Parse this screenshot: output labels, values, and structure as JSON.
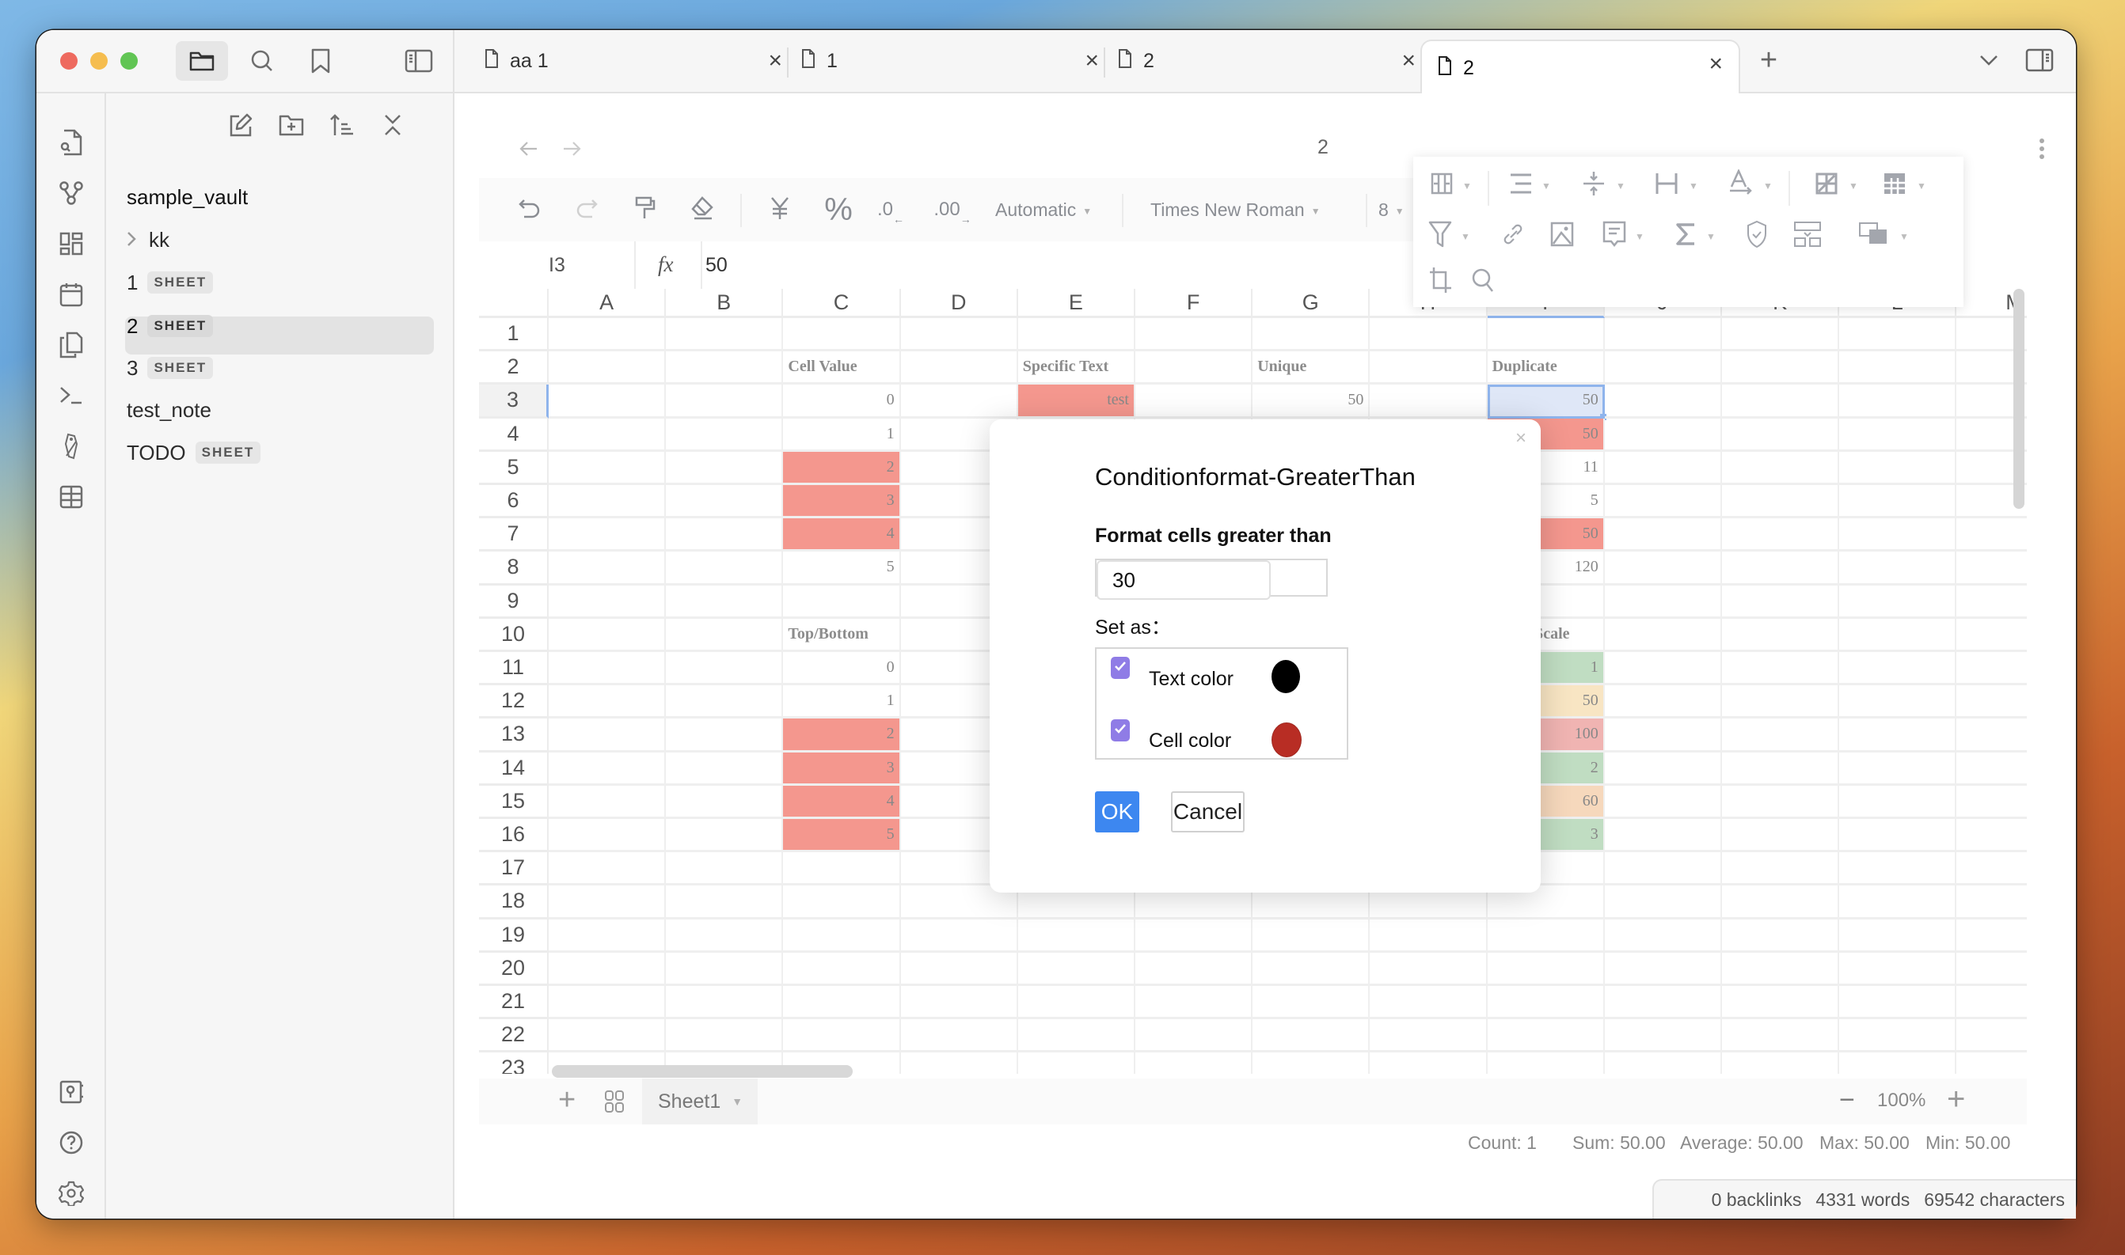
{
  "window": {
    "traffic_lights": {
      "close": "#ee6a5f",
      "minimize": "#f5bd4f",
      "maximize": "#61c554"
    },
    "top_icons": [
      "folder-icon",
      "search-icon",
      "bookmark-icon",
      "sidebar-toggle-icon"
    ]
  },
  "tabs": [
    {
      "label": "aa 1",
      "active": false
    },
    {
      "label": "1",
      "active": false
    },
    {
      "label": "2",
      "active": false
    },
    {
      "label": "2",
      "active": true
    }
  ],
  "tab_controls": {
    "new_tab": "+",
    "close": "×"
  },
  "nav": {
    "title": "2"
  },
  "ribbon": {
    "top": [
      "file-search-icon",
      "graph-icon",
      "dashboard-icon",
      "calendar-icon",
      "copy-icon",
      "terminal-icon",
      "tag-icon",
      "table-icon"
    ],
    "bottom": [
      "vault-icon",
      "help-icon",
      "settings-icon"
    ]
  },
  "sidebar": {
    "actions": [
      "new-note-icon",
      "new-folder-icon",
      "sort-icon",
      "collapse-icon"
    ],
    "vault_name": "sample_vault",
    "items": [
      {
        "label": "kk",
        "type": "folder",
        "badge": null
      },
      {
        "label": "1",
        "badge": "SHEET"
      },
      {
        "label": "2",
        "badge": "SHEET",
        "active": true
      },
      {
        "label": "3",
        "badge": "SHEET"
      },
      {
        "label": "test_note",
        "badge": null
      },
      {
        "label": "TODO",
        "badge": "SHEET"
      }
    ]
  },
  "toolbar": {
    "number_format": "Automatic",
    "font_family": "Times New Roman",
    "font_size": "8",
    "icons": [
      "undo-icon",
      "redo-icon",
      "format-painter-icon",
      "clear-format-icon",
      "currency-icon",
      "percent-icon",
      "decrease-decimal-icon",
      "increase-decimal-icon"
    ],
    "decrease_decimal": ".0",
    "increase_decimal": ".00"
  },
  "floating_toolbar": {
    "icons": [
      "merge-cells-icon",
      "horizontal-align-icon",
      "vertical-align-icon",
      "text-wrap-icon",
      "text-rotate-icon",
      "border-icon",
      "freeze-icon",
      "filter-icon",
      "link-icon",
      "image-icon",
      "comment-icon",
      "sum-icon",
      "protect-icon",
      "split-column-icon",
      "conditional-format-icon",
      "crop-icon",
      "find-icon"
    ]
  },
  "formula_bar": {
    "cell_ref": "I3",
    "fx": "fx",
    "value": "50"
  },
  "grid": {
    "columns": [
      "A",
      "B",
      "C",
      "D",
      "E",
      "F",
      "G",
      "H",
      "I",
      "J",
      "K",
      "L",
      "M"
    ],
    "rows": [
      "1",
      "2",
      "3",
      "4",
      "5",
      "6",
      "7",
      "8",
      "9",
      "10",
      "11",
      "12",
      "13",
      "14",
      "15",
      "16",
      "17",
      "18",
      "19",
      "20",
      "21",
      "22",
      "23"
    ],
    "selected_cell": "I3",
    "cells": [
      {
        "ref": "C2",
        "value": "Cell Value",
        "header": true
      },
      {
        "ref": "E2",
        "value": "Specific Text",
        "header": true
      },
      {
        "ref": "G2",
        "value": "Unique",
        "header": true
      },
      {
        "ref": "I2",
        "value": "Duplicate",
        "header": true
      },
      {
        "ref": "C3",
        "value": "0"
      },
      {
        "ref": "E3",
        "value": "test",
        "fill": "#f4978e"
      },
      {
        "ref": "G3",
        "value": "50"
      },
      {
        "ref": "I3",
        "value": "50",
        "fill": "#dfe7f7"
      },
      {
        "ref": "C4",
        "value": "1"
      },
      {
        "ref": "I4",
        "value": "50",
        "fill": "#f4978e"
      },
      {
        "ref": "C5",
        "value": "2",
        "fill": "#f4978e"
      },
      {
        "ref": "I5",
        "value": "11"
      },
      {
        "ref": "C6",
        "value": "3",
        "fill": "#f4978e"
      },
      {
        "ref": "I6",
        "value": "5"
      },
      {
        "ref": "C7",
        "value": "4",
        "fill": "#f4978e"
      },
      {
        "ref": "I7",
        "value": "50",
        "fill": "#f4978e"
      },
      {
        "ref": "C8",
        "value": "5"
      },
      {
        "ref": "I8",
        "value": "120"
      },
      {
        "ref": "C10",
        "value": "Top/Bottom",
        "header": true
      },
      {
        "ref": "I10",
        "value": "Color Scale",
        "header": true
      },
      {
        "ref": "C11",
        "value": "0"
      },
      {
        "ref": "I11",
        "value": "1",
        "fill": "#c0ddc2"
      },
      {
        "ref": "C12",
        "value": "1"
      },
      {
        "ref": "I12",
        "value": "50",
        "fill": "#f8e5c3"
      },
      {
        "ref": "C13",
        "value": "2",
        "fill": "#f4978e"
      },
      {
        "ref": "I13",
        "value": "100",
        "fill": "#f0b4b2"
      },
      {
        "ref": "C14",
        "value": "3",
        "fill": "#f4978e"
      },
      {
        "ref": "I14",
        "value": "2",
        "fill": "#c0ddc2"
      },
      {
        "ref": "C15",
        "value": "4",
        "fill": "#f4978e"
      },
      {
        "ref": "I15",
        "value": "60",
        "fill": "#f6d8bc"
      },
      {
        "ref": "C16",
        "value": "5",
        "fill": "#f4978e"
      },
      {
        "ref": "I16",
        "value": "3",
        "fill": "#c0ddc2"
      }
    ]
  },
  "sheetbar": {
    "add": "+",
    "sheet_name": "Sheet1",
    "zoom_out": "−",
    "zoom_level": "100%",
    "zoom_in": "+"
  },
  "stats": {
    "count": "Count: 1",
    "sum": "Sum: 50.00",
    "average": "Average: 50.00",
    "max": "Max: 50.00",
    "min": "Min: 50.00"
  },
  "statusbar": {
    "backlinks": "0 backlinks",
    "words": "4331 words",
    "characters": "69542 characters"
  },
  "dialog": {
    "title": "Conditionformat-GreaterThan",
    "label": "Format cells greater than",
    "value": "30",
    "set_as": "Set as：",
    "options": [
      {
        "label": "Text color",
        "checked": true,
        "color": "#000000"
      },
      {
        "label": "Cell color",
        "checked": true,
        "color": "#b82d24"
      }
    ],
    "ok": "OK",
    "cancel": "Cancel",
    "close": "×"
  }
}
